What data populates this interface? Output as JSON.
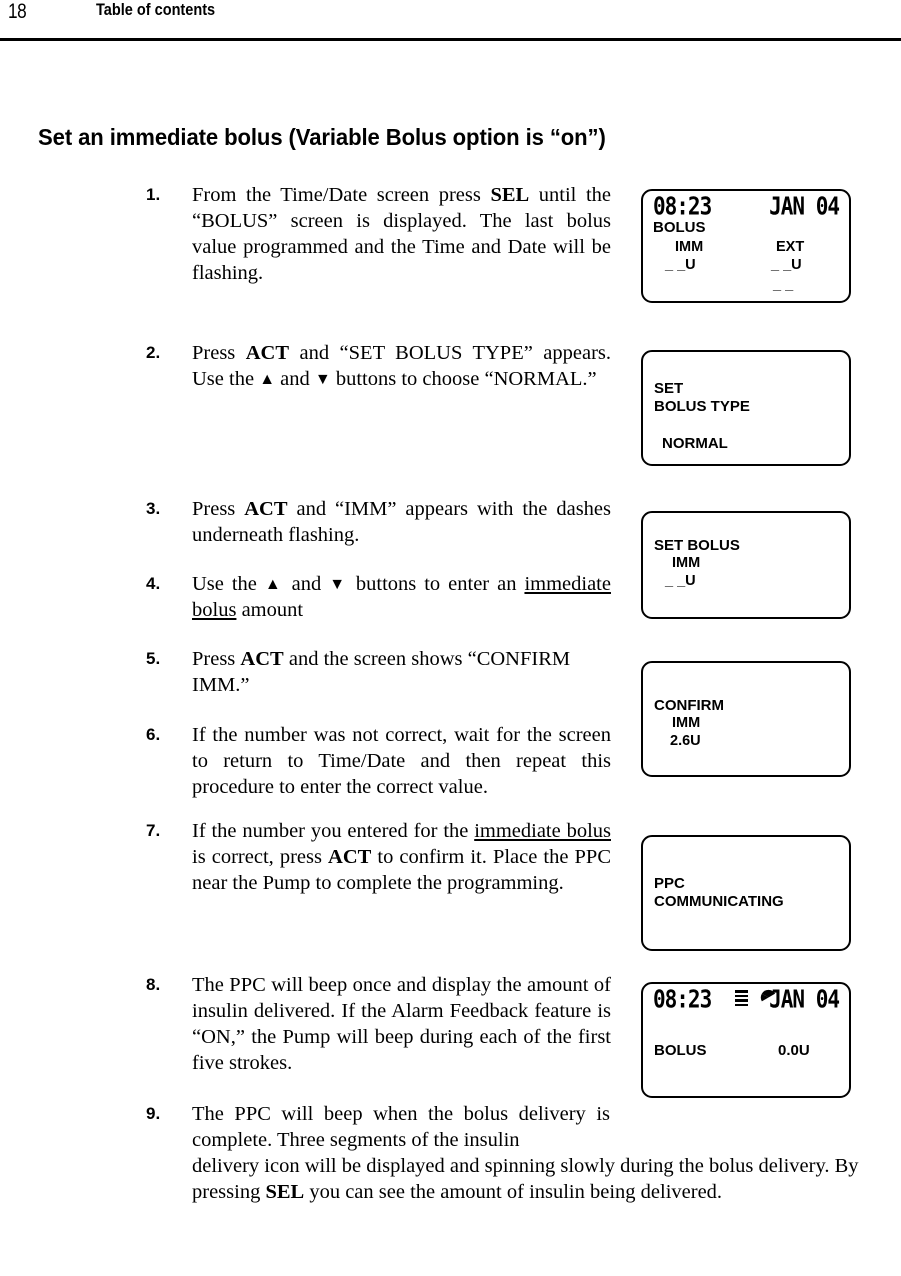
{
  "header": {
    "page_number": "18",
    "title": "Table of contents"
  },
  "section": {
    "title": "Set an immediate bolus (Variable Bolus option is “on”)"
  },
  "steps": [
    {
      "number": "1.",
      "text_plain": "From the Time/Date screen press SEL until the “BOLUS” screen is displayed. The last bolus value programmed and the Time and Date will be flashing."
    },
    {
      "number": "2.",
      "text_plain": "Press ACT and “SET BOLUS TYPE” appears. Use the ▲ and ▼ buttons to choose “NORMAL.”"
    },
    {
      "number": "3.",
      "text_plain": "Press ACT and “IMM” appears with the dashes underneath flashing."
    },
    {
      "number": "4.",
      "text_plain": "Use the ▲ and ▼ buttons to enter an immediate bolus amount"
    },
    {
      "number": "5.",
      "text_plain": "Press ACT and the screen shows “CONFIRM IMM.”"
    },
    {
      "number": "6.",
      "text_plain": "If the number was not correct, wait for the screen to return to Time/Date and then repeat this procedure to enter the correct value."
    },
    {
      "number": "7.",
      "text_plain": "If the number you entered for the immediate bolus is correct, press ACT to confirm it. Place the PPC near the Pump to complete the programming."
    },
    {
      "number": "8.",
      "text_plain": "The PPC will beep once and display the amount of insulin delivered. If the Alarm Feedback feature is “ON,” the Pump will beep during each of the first five strokes."
    },
    {
      "number": "9.",
      "text_plain": "The PPC will beep when the bolus delivery is complete. Three segments of the insulin delivery icon will be displayed and spinning slowly during the bolus delivery. By pressing SEL you can see the amount of insulin being delivered."
    }
  ],
  "step_fragments": {
    "s1": {
      "a": "From the Time/Date screen press ",
      "sel": "SEL",
      "b": " until the “BOLUS” screen is displayed. The last bolus value programmed and the Time and Date will be flashing."
    },
    "s2": {
      "a": "Press ",
      "act": "ACT",
      "b": " and “SET BOLUS TYPE” appears. Use the ",
      "up": "▲",
      "c": " and ",
      "down": "▼",
      "d": " buttons to choose “NORMAL.”"
    },
    "s3": {
      "a": "Press ",
      "act": "ACT",
      "b": " and “IMM” appears with the dashes underneath flashing."
    },
    "s4": {
      "a": "Use the ",
      "up": "▲",
      "b": " and ",
      "down": "▼",
      "c": " buttons to enter an ",
      "link": "immediate bolus",
      "d": " amount"
    },
    "s5": {
      "a": "Press ",
      "act": "ACT",
      "b": " and the screen shows “CONFIRM IMM.”"
    },
    "s6": {
      "a": "If the number was not correct, wait for the screen to return to Time/Date and then repeat this procedure to enter the correct value."
    },
    "s7": {
      "a": "If the number you entered for the ",
      "link": "immediate bolus",
      "b": " is correct, press ",
      "act": "ACT",
      "c": " to confirm it. Place the PPC near the Pump to complete the programming."
    },
    "s8": {
      "a": "The PPC will beep once and display the amount of insulin delivered. If the Alarm Feedback feature is “ON,” the Pump will beep during each of the first five strokes."
    },
    "s9": {
      "a": "The PPC will beep when the bolus delivery is complete. Three segments of the insulin ",
      "b": "delivery icon will be displayed and spinning slowly during the bolus delivery. By pressing ",
      "sel": "SEL",
      "c": " you can see the amount of insulin being delivered."
    }
  },
  "lcd_screens": [
    {
      "id": "bolus-main",
      "time": "08:23",
      "date": "JAN 04",
      "label": "BOLUS",
      "imm_label": "IMM",
      "imm_value": "_ _U",
      "ext_label": "EXT",
      "ext_value": "_ _U",
      "ext_extra": "_ _"
    },
    {
      "id": "set-bolus-type",
      "line1": "SET",
      "line2": "BOLUS TYPE",
      "line3": "NORMAL"
    },
    {
      "id": "set-bolus-imm",
      "line1": "SET BOLUS",
      "line2": "IMM",
      "line3": "_ _U"
    },
    {
      "id": "confirm-imm",
      "line1": "CONFIRM",
      "line2": "IMM",
      "line3": "2.6U"
    },
    {
      "id": "ppc-communicating",
      "line1": "PPC",
      "line2": "COMMUNICATING"
    },
    {
      "id": "bolus-delivered",
      "time": "08:23",
      "date": "JAN 04",
      "label": "BOLUS",
      "value": "0.0U",
      "icons": [
        "reservoir-bars-icon",
        "delivery-spinner-icon"
      ]
    }
  ],
  "colors": {
    "text": "#000000",
    "background": "#ffffff",
    "rule": "#000000"
  }
}
